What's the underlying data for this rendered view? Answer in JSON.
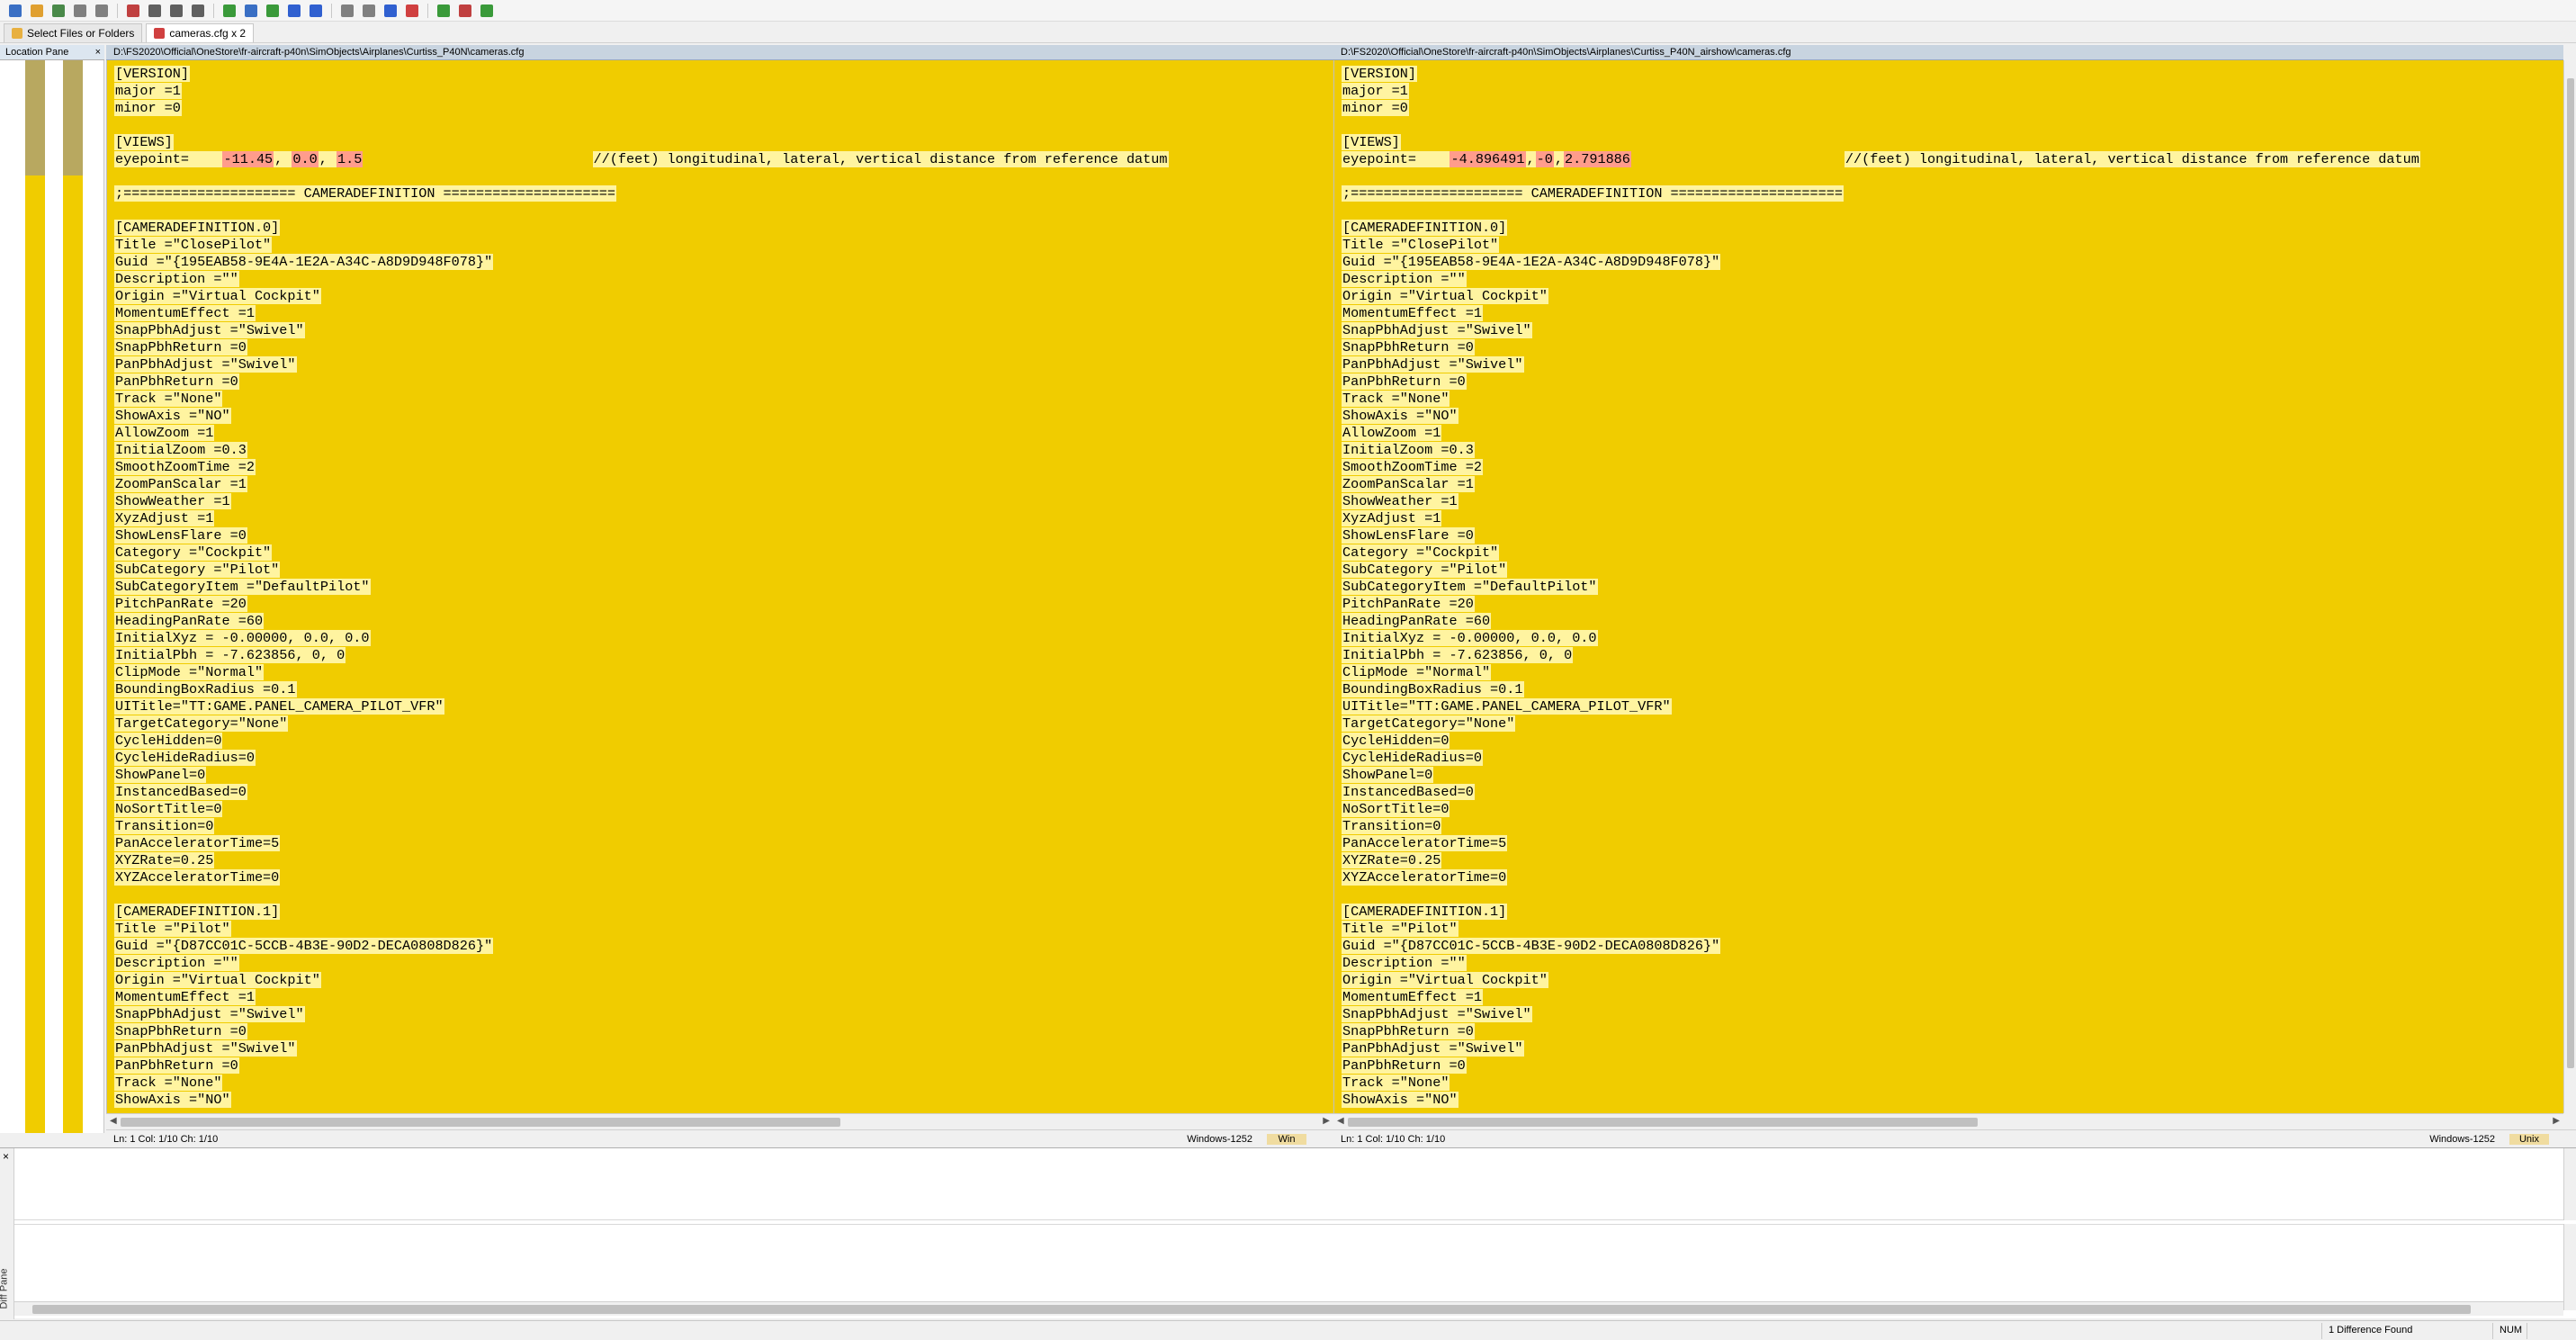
{
  "toolbar": {
    "icons": [
      "new-file-icon",
      "open-folder-icon",
      "save-icon",
      "undo-icon",
      "redo-icon",
      "bookmark-icon",
      "copy-icon",
      "cut-icon",
      "paste-icon",
      "compare-icon",
      "merge-icon",
      "sync-icon",
      "next-diff-icon",
      "prev-diff-icon",
      "first-diff-icon",
      "last-diff-icon",
      "copy-left-icon",
      "copy-right-icon",
      "refresh-icon",
      "options-icon",
      "help-icon"
    ]
  },
  "tabs": [
    {
      "label": "Select Files or Folders"
    },
    {
      "label": "cameras.cfg x 2"
    }
  ],
  "location_pane": {
    "title": "Location Pane",
    "close": "×"
  },
  "left": {
    "path": "D:\\FS2020\\Official\\OneStore\\fr-aircraft-p40n\\SimObjects\\Airplanes\\Curtiss_P40N\\cameras.cfg",
    "status_pos": "Ln: 1  Col: 1/10  Ch: 1/10",
    "encoding": "Windows-1252",
    "eol": "Win",
    "eyepoint_label": "eyepoint=    ",
    "eyepoint_vals": [
      "-11.45",
      "0.0",
      "1.5"
    ],
    "eyepoint_comment": "//(feet) longitudinal, lateral, vertical distance from reference datum"
  },
  "right": {
    "path": "D:\\FS2020\\Official\\OneStore\\fr-aircraft-p40n\\SimObjects\\Airplanes\\Curtiss_P40N_airshow\\cameras.cfg",
    "status_pos": "Ln: 1  Col: 1/10  Ch: 1/10",
    "encoding": "Windows-1252",
    "eol": "Unix",
    "eyepoint_label": "eyepoint=    ",
    "eyepoint_vals": [
      "-4.896491",
      "-0",
      "2.791886"
    ],
    "eyepoint_comment": "//(feet) longitudinal, lateral, vertical distance from reference datum"
  },
  "lines": [
    "[VERSION]",
    "major =1",
    "minor =0",
    "",
    "[VIEWS]",
    "@EYEPOINT@",
    "",
    ";===================== CAMERADEFINITION =====================",
    "",
    "[CAMERADEFINITION.0]",
    "Title =\"ClosePilot\"",
    "Guid =\"{195EAB58-9E4A-1E2A-A34C-A8D9D948F078}\"",
    "Description =\"\"",
    "Origin =\"Virtual Cockpit\"",
    "MomentumEffect =1",
    "SnapPbhAdjust =\"Swivel\"",
    "SnapPbhReturn =0",
    "PanPbhAdjust =\"Swivel\"",
    "PanPbhReturn =0",
    "Track =\"None\"",
    "ShowAxis =\"NO\"",
    "AllowZoom =1",
    "InitialZoom =0.3",
    "SmoothZoomTime =2",
    "ZoomPanScalar =1",
    "ShowWeather =1",
    "XyzAdjust =1",
    "ShowLensFlare =0",
    "Category =\"Cockpit\"",
    "SubCategory =\"Pilot\"",
    "SubCategoryItem =\"DefaultPilot\"",
    "PitchPanRate =20",
    "HeadingPanRate =60",
    "InitialXyz = -0.00000, 0.0, 0.0",
    "InitialPbh = -7.623856, 0, 0",
    "ClipMode =\"Normal\"",
    "BoundingBoxRadius =0.1",
    "UITitle=\"TT:GAME.PANEL_CAMERA_PILOT_VFR\"",
    "TargetCategory=\"None\"",
    "CycleHidden=0",
    "CycleHideRadius=0",
    "ShowPanel=0",
    "InstancedBased=0",
    "NoSortTitle=0",
    "Transition=0",
    "PanAcceleratorTime=5",
    "XYZRate=0.25",
    "XYZAcceleratorTime=0",
    "",
    "[CAMERADEFINITION.1]",
    "Title =\"Pilot\"",
    "Guid =\"{D87CC01C-5CCB-4B3E-90D2-DECA0808D826}\"",
    "Description =\"\"",
    "Origin =\"Virtual Cockpit\"",
    "MomentumEffect =1",
    "SnapPbhAdjust =\"Swivel\"",
    "SnapPbhReturn =0",
    "PanPbhAdjust =\"Swivel\"",
    "PanPbhReturn =0",
    "Track =\"None\"",
    "ShowAxis =\"NO\""
  ],
  "diff_pane": {
    "close": "×",
    "title": "Diff Pane"
  },
  "statusbar": {
    "found": "1 Difference Found",
    "num": "NUM"
  },
  "colors": {
    "changed_bg": "#f0cc00",
    "text_bg": "#fff4a0",
    "diff_char": "#ff9c8c",
    "path_bar": "#c8d4e0"
  }
}
